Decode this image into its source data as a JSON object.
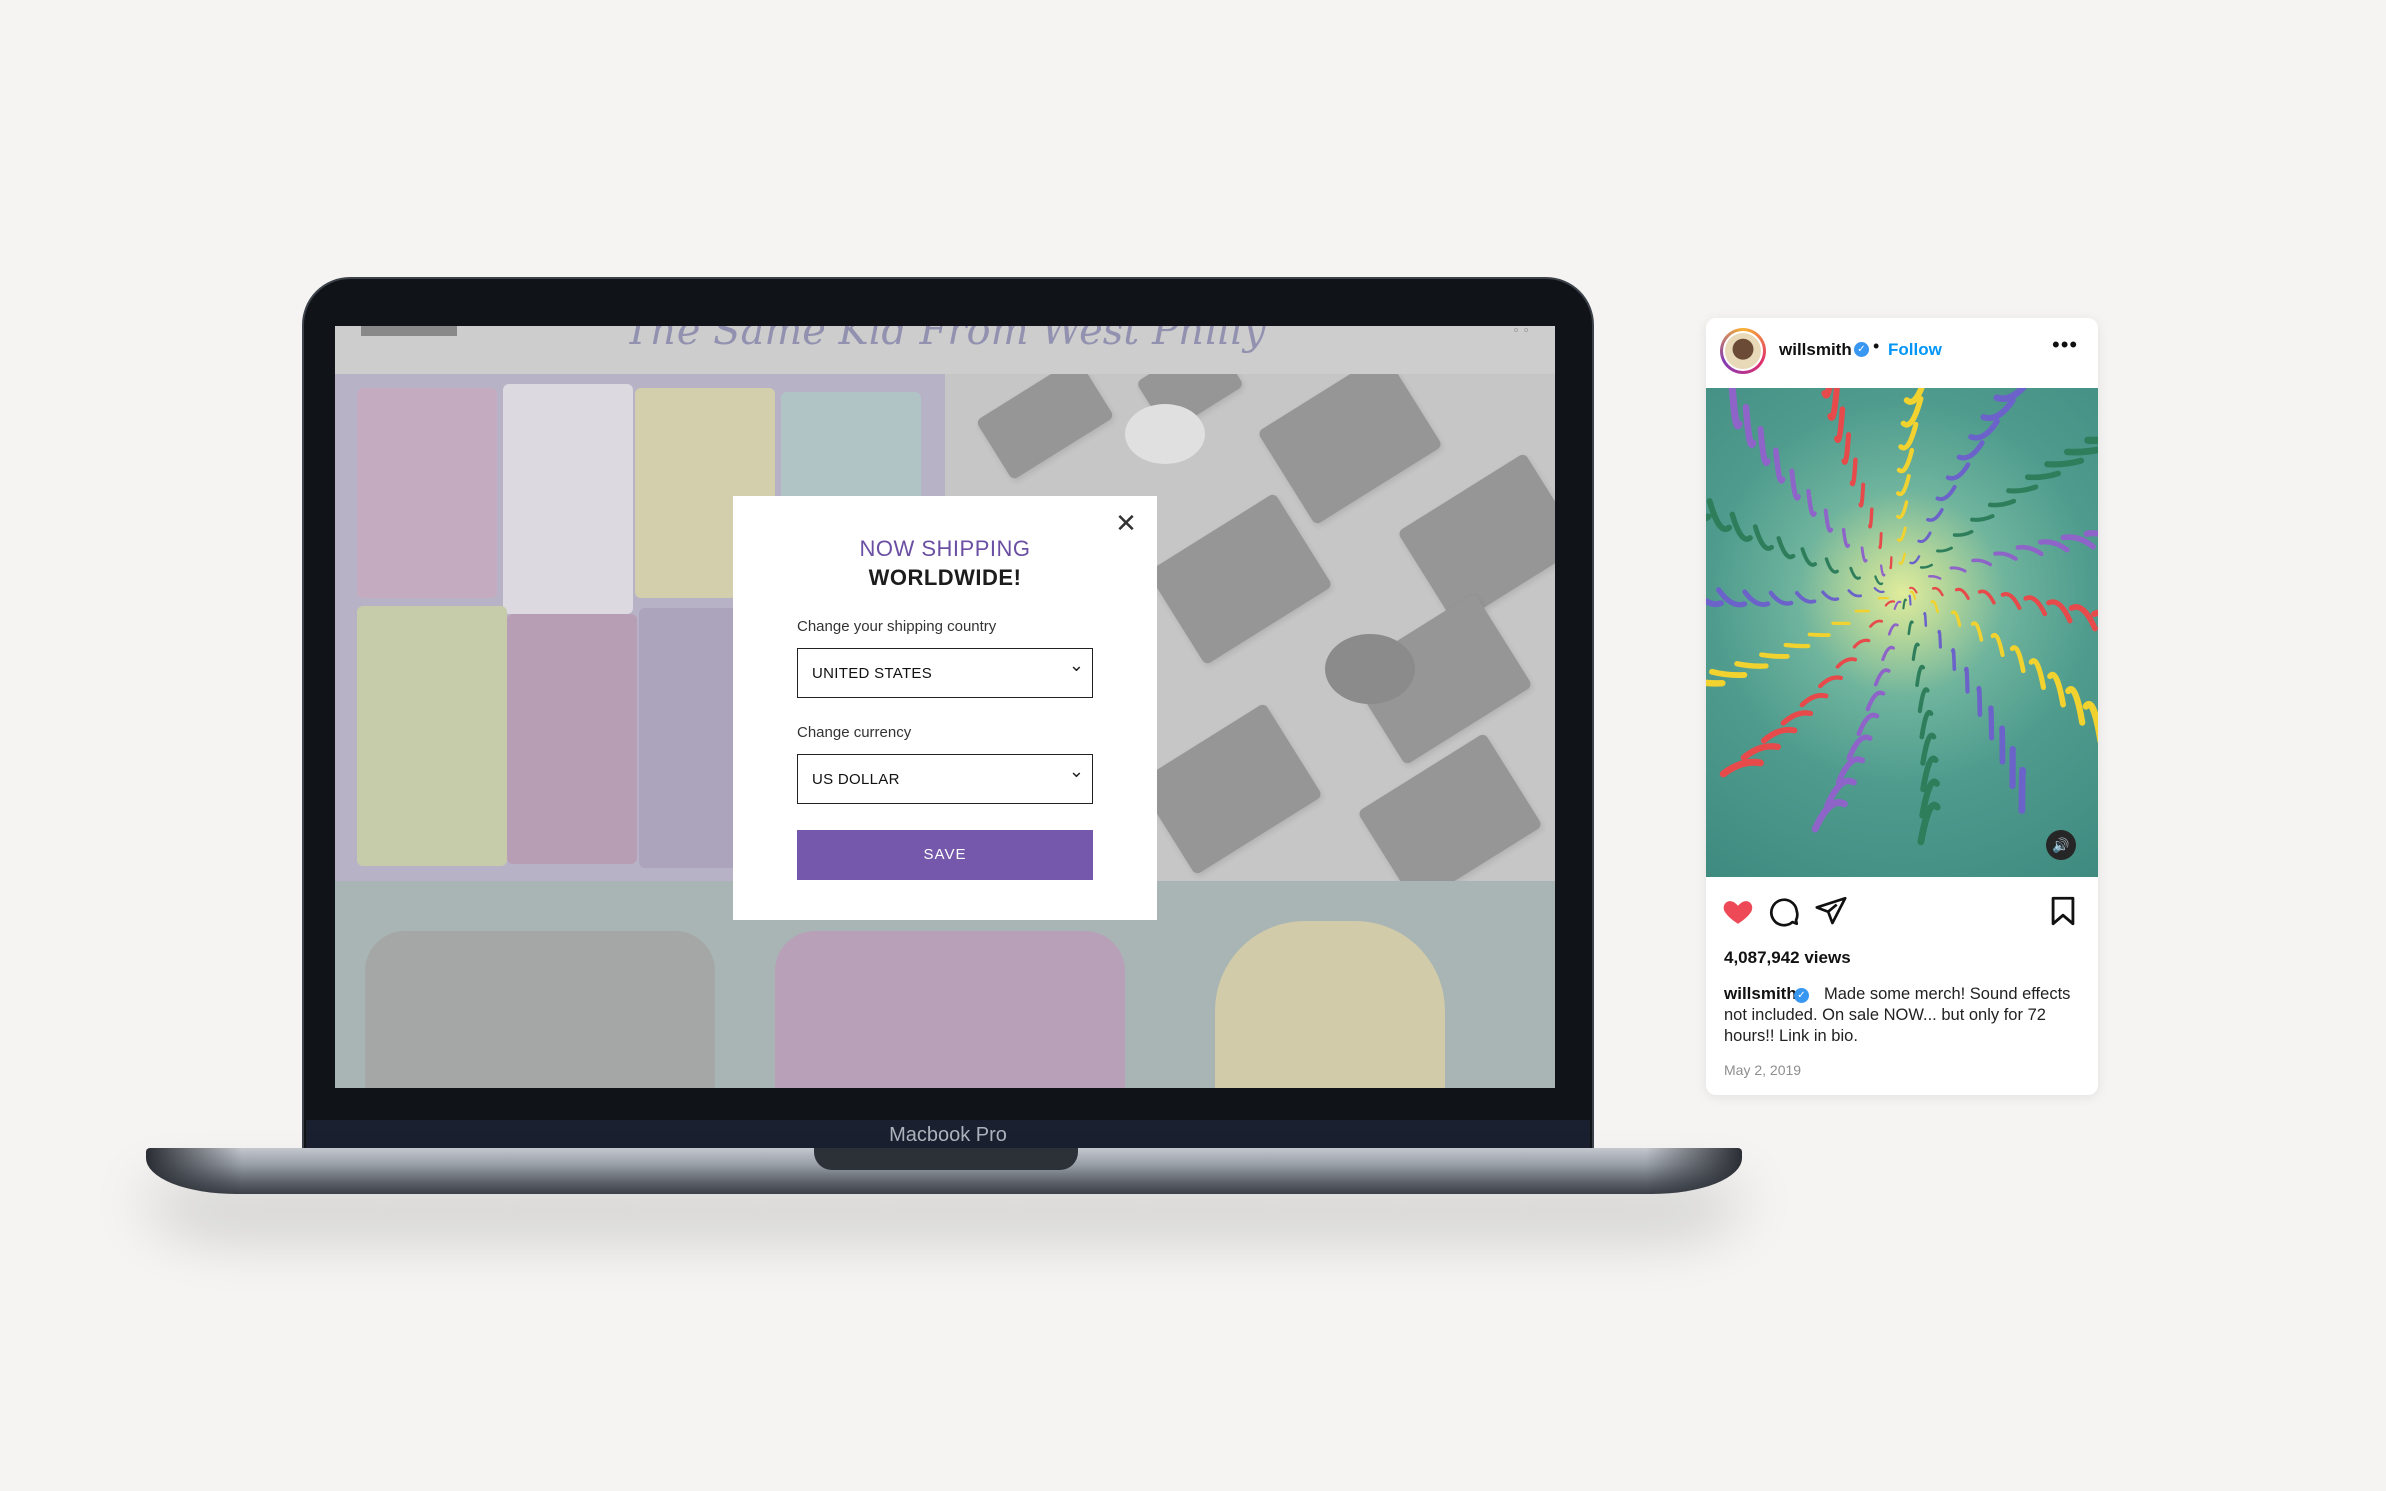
{
  "laptop": {
    "model_label": "Macbook Pro",
    "site": {
      "tagline": "The Same Kid From West Philly",
      "modal": {
        "title_line1": "NOW SHIPPING",
        "title_line2": "WORLDWIDE!",
        "close_icon": "close-icon",
        "country_label": "Change your shipping country",
        "country_value": "UNITED STATES",
        "currency_label": "Change currency",
        "currency_value": "US DOLLAR",
        "save_label": "SAVE"
      }
    }
  },
  "instagram": {
    "username": "willsmith",
    "verified": true,
    "separator": "•",
    "follow_label": "Follow",
    "more_icon": "more-icon",
    "views": "4,087,942 views",
    "caption_user": "willsmith",
    "caption": "Made some merch! Sound effects not included. On sale NOW... but only for 72 hours!! Link in bio.",
    "date": "May 2, 2019",
    "liked": true,
    "colors": {
      "accent_link": "#0095f6",
      "like_red": "#ed4956",
      "modal_purple": "#6b4fa3",
      "save_button": "#7558ab"
    }
  }
}
